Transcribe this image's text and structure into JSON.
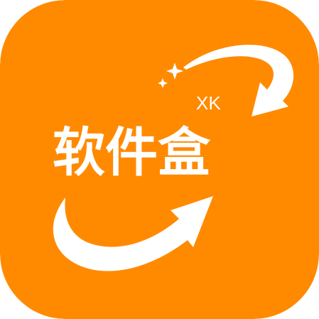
{
  "app_icon": {
    "background_color": "#FF8A00",
    "foreground_color": "#FFFFFF",
    "wordmark": "软件盒",
    "badge": "XK",
    "decorations": [
      "curved-arrow-icon",
      "sparkle-icon",
      "swoosh-arrow-icon"
    ]
  }
}
